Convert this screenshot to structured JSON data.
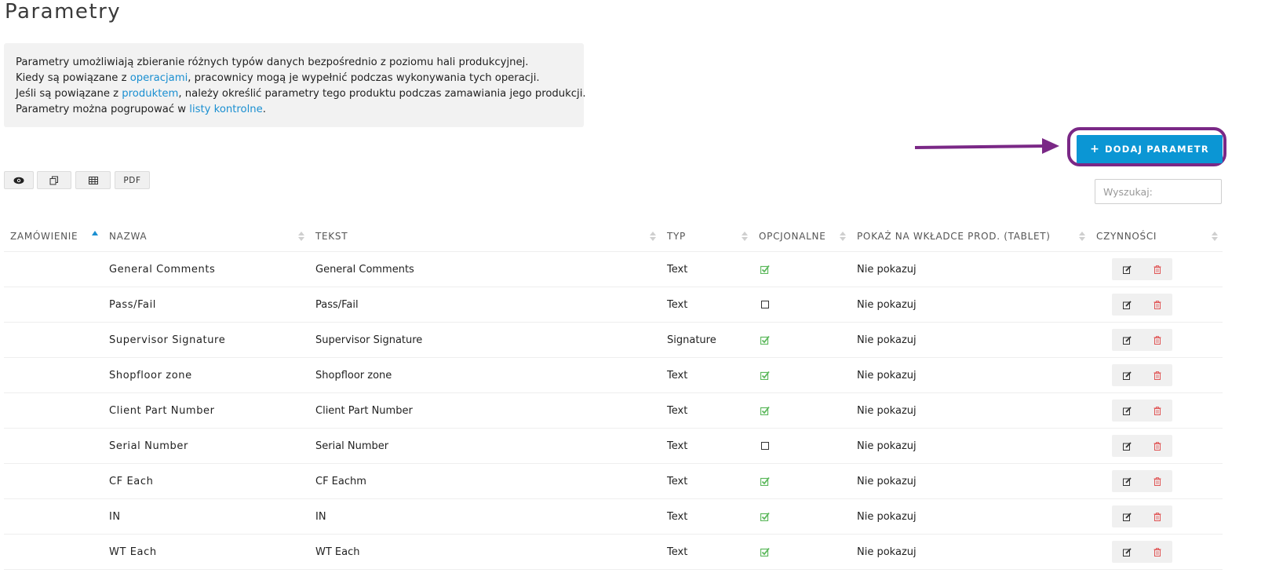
{
  "page": {
    "title": "Parametry"
  },
  "info": {
    "line1": "Parametry umożliwiają zbieranie różnych typów danych bezpośrednio z poziomu hali produkcyjnej.",
    "line2_pre": "Kiedy są powiązane z ",
    "line2_link": "operacjami",
    "line2_post": ", pracownicy mogą je wypełnić podczas wykonywania tych operacji.",
    "line3_pre": "Jeśli są powiązane z ",
    "line3_link": "produktem",
    "line3_post": ", należy określić parametry tego produktu podczas zamawiania jego produkcji.",
    "line4_pre": "Parametry można pogrupować w ",
    "line4_link": "listy kontrolne",
    "line4_post": "."
  },
  "toolbar": {
    "add_label": "DODAJ PARAMETR",
    "pdf_label": "PDF"
  },
  "search": {
    "placeholder": "Wyszukaj:"
  },
  "table": {
    "headers": [
      "ZAMÓWIENIE",
      "NAZWA",
      "TEKST",
      "TYP",
      "OPCJONALNE",
      "POKAŻ NA WKŁADCE PROD. (TABLET)",
      "CZYNNOŚCI"
    ],
    "rows": [
      {
        "order": "",
        "name": "General Comments",
        "text": "General Comments",
        "type": "Text",
        "optional": true,
        "show": "Nie pokazuj"
      },
      {
        "order": "",
        "name": "Pass/Fail",
        "text": "Pass/Fail",
        "type": "Text",
        "optional": false,
        "show": "Nie pokazuj"
      },
      {
        "order": "",
        "name": "Supervisor Signature",
        "text": "Supervisor Signature",
        "type": "Signature",
        "optional": true,
        "show": "Nie pokazuj"
      },
      {
        "order": "",
        "name": "Shopfloor zone",
        "text": "Shopfloor zone",
        "type": "Text",
        "optional": true,
        "show": "Nie pokazuj"
      },
      {
        "order": "",
        "name": "Client Part Number",
        "text": "Client Part Number",
        "type": "Text",
        "optional": true,
        "show": "Nie pokazuj"
      },
      {
        "order": "",
        "name": "Serial Number",
        "text": "Serial Number",
        "type": "Text",
        "optional": false,
        "show": "Nie pokazuj"
      },
      {
        "order": "",
        "name": "CF Each",
        "text": "CF Eachm",
        "type": "Text",
        "optional": true,
        "show": "Nie pokazuj"
      },
      {
        "order": "",
        "name": "IN",
        "text": "IN",
        "type": "Text",
        "optional": true,
        "show": "Nie pokazuj"
      },
      {
        "order": "",
        "name": "WT Each",
        "text": "WT Each",
        "type": "Text",
        "optional": true,
        "show": "Nie pokazuj"
      }
    ]
  },
  "colors": {
    "accent": "#0b96d4",
    "link": "#1a8fd1",
    "highlight": "#7a2886",
    "check": "#5cb85c",
    "delete": "#e05555"
  }
}
